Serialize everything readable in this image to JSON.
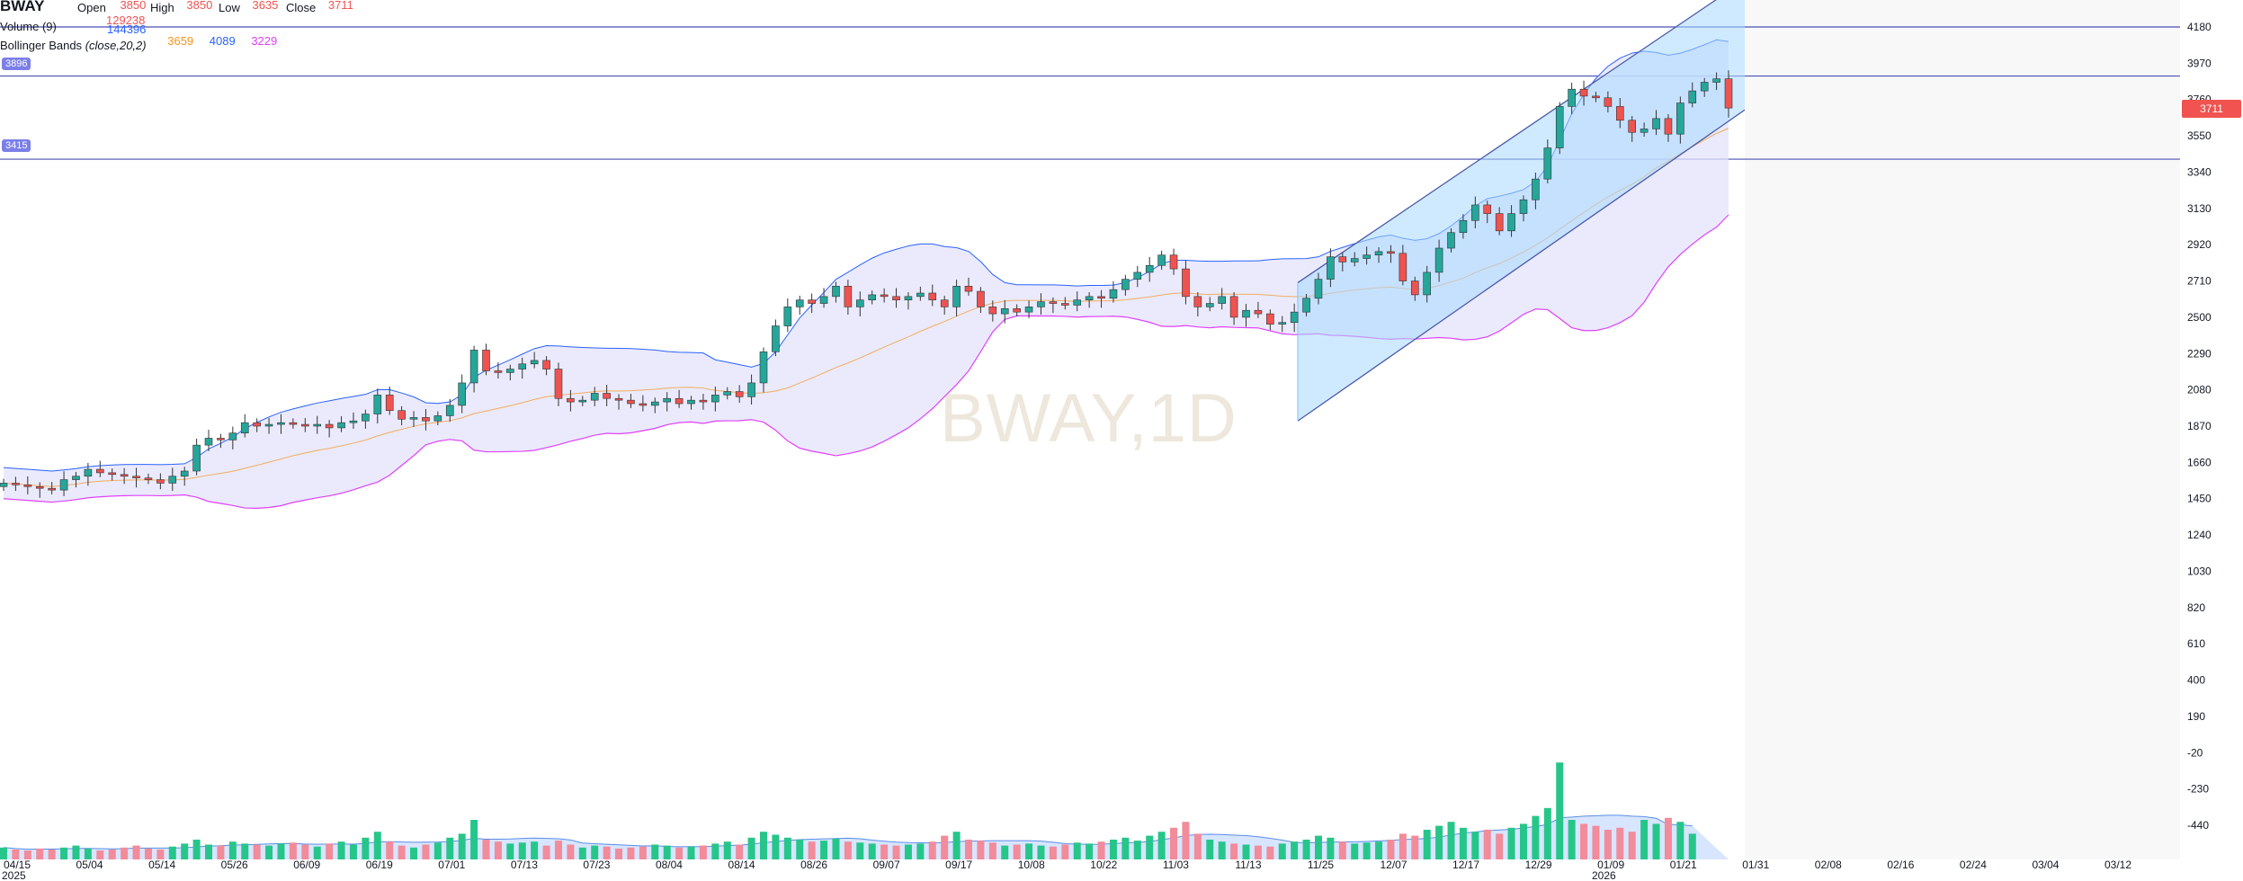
{
  "symbol": "BWAY",
  "ohlc": {
    "open_label": "Open",
    "open": "3850",
    "high_label": "High",
    "high": "3850",
    "low_label": "Low",
    "low": "3635",
    "close_label": "Close",
    "close": "3711"
  },
  "volume": {
    "label": "Volume (9)",
    "value_1": "129238",
    "value_2": "144396"
  },
  "bollinger": {
    "label": "Bollinger Bands",
    "params": "(close,20,2)",
    "basis": "3659",
    "upper": "4089",
    "lower": "3229"
  },
  "level_tags": {
    "upper": "3896",
    "lower": "3415"
  },
  "price_tag": "3711",
  "watermark": "BWAY,1D",
  "colors": {
    "up": "#26a69a",
    "down": "#ef5350",
    "band_fill": "#e3e3fb",
    "band_upper": "#2962ff",
    "band_lower": "#e040fb",
    "basis": "#f7931a",
    "channel_fill": "#a8d8ff",
    "hline": "#4b4fb5"
  },
  "chart_data": {
    "type": "candlestick",
    "title": "BWAY,1D",
    "y_ticks": [
      4180,
      3970,
      3760,
      3550,
      3340,
      3130,
      2920,
      2710,
      2500,
      2290,
      2080,
      1870,
      1660,
      1450,
      1240,
      1030,
      820,
      610,
      400,
      190,
      -20,
      -230,
      -440
    ],
    "ylim": [
      -650,
      4200
    ],
    "x_tick_labels": [
      "04/15",
      "05/04",
      "05/14",
      "05/26",
      "06/09",
      "06/19",
      "07/01",
      "07/13",
      "07/23",
      "08/04",
      "08/14",
      "08/26",
      "09/07",
      "09/17",
      "10/08",
      "10/22",
      "11/03",
      "11/13",
      "11/25",
      "12/07",
      "12/17",
      "12/29",
      "01/09",
      "01/21",
      "01/31",
      "02/08",
      "02/16",
      "02/24",
      "03/04",
      "03/12"
    ],
    "x_year_labels": [
      "2025",
      "2026"
    ],
    "horizontal_levels": [
      4180,
      3896,
      3415
    ],
    "channel": {
      "start": "11/25",
      "end": "01/31",
      "lower_start": 1900,
      "lower_end": 3700,
      "upper_start": 2700,
      "upper_end": 4450
    },
    "closes": [
      1540,
      1530,
      1520,
      1510,
      1500,
      1560,
      1580,
      1620,
      1600,
      1590,
      1580,
      1570,
      1560,
      1540,
      1580,
      1610,
      1760,
      1800,
      1790,
      1830,
      1890,
      1870,
      1880,
      1890,
      1880,
      1870,
      1880,
      1860,
      1890,
      1900,
      1940,
      2050,
      1960,
      1910,
      1920,
      1900,
      1930,
      1990,
      2120,
      2310,
      2190,
      2180,
      2200,
      2230,
      2250,
      2200,
      2030,
      2010,
      2020,
      2060,
      2030,
      2020,
      2000,
      1990,
      2010,
      2030,
      2000,
      2020,
      2010,
      2050,
      2070,
      2040,
      2120,
      2300,
      2450,
      2560,
      2600,
      2580,
      2620,
      2680,
      2560,
      2600,
      2630,
      2620,
      2600,
      2620,
      2640,
      2600,
      2560,
      2680,
      2650,
      2560,
      2520,
      2550,
      2530,
      2560,
      2590,
      2580,
      2570,
      2600,
      2620,
      2610,
      2660,
      2720,
      2760,
      2800,
      2860,
      2780,
      2620,
      2560,
      2580,
      2620,
      2500,
      2540,
      2520,
      2460,
      2470,
      2530,
      2610,
      2720,
      2850,
      2820,
      2840,
      2860,
      2880,
      2870,
      2710,
      2630,
      2760,
      2900,
      2990,
      3060,
      3150,
      3100,
      3000,
      3100,
      3180,
      3300,
      3480,
      3720,
      3820,
      3780,
      3770,
      3720,
      3640,
      3570,
      3590,
      3650,
      3560,
      3740,
      3810,
      3860,
      3880,
      3711
    ],
    "volumes_scaled": [
      12,
      10,
      9,
      11,
      10,
      12,
      14,
      11,
      9,
      10,
      12,
      14,
      11,
      10,
      13,
      16,
      20,
      15,
      14,
      18,
      16,
      15,
      14,
      16,
      17,
      15,
      13,
      16,
      18,
      15,
      22,
      28,
      18,
      14,
      12,
      15,
      17,
      22,
      26,
      40,
      20,
      18,
      16,
      17,
      18,
      14,
      19,
      15,
      12,
      14,
      13,
      11,
      12,
      13,
      15,
      14,
      12,
      13,
      14,
      16,
      18,
      15,
      22,
      28,
      25,
      22,
      20,
      18,
      19,
      21,
      18,
      17,
      16,
      15,
      14,
      15,
      16,
      18,
      24,
      28,
      20,
      19,
      17,
      14,
      15,
      16,
      14,
      13,
      15,
      17,
      16,
      18,
      20,
      22,
      19,
      24,
      28,
      32,
      38,
      26,
      20,
      18,
      16,
      15,
      14,
      13,
      16,
      18,
      20,
      24,
      22,
      18,
      16,
      17,
      18,
      20,
      26,
      24,
      30,
      34,
      38,
      32,
      28,
      30,
      26,
      32,
      36,
      44,
      52,
      98,
      40,
      36,
      34,
      30,
      32,
      28,
      40,
      36,
      42,
      38,
      26
    ]
  }
}
